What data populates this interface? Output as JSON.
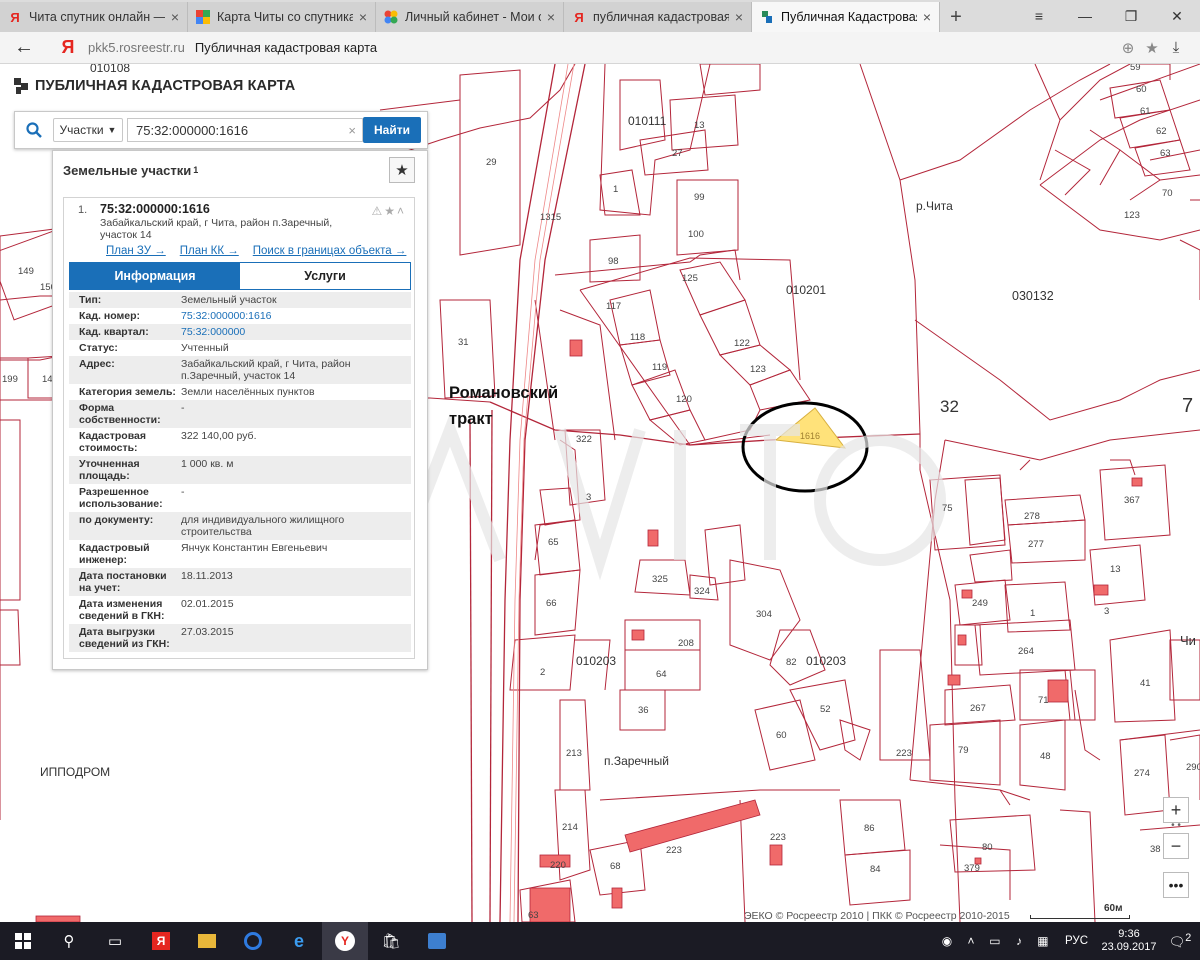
{
  "browser": {
    "tabs": [
      {
        "title": "Чита спутник онлайн — Ян",
        "favicon": "yandex-icon",
        "active": false
      },
      {
        "title": "Карта Читы со спутника - у",
        "favicon": "map-icon",
        "active": false
      },
      {
        "title": "Личный кабинет - Мои объ",
        "favicon": "colorful-icon",
        "active": false
      },
      {
        "title": "публичная кадастровая кар",
        "favicon": "yandex-icon",
        "active": false
      },
      {
        "title": "Публичная Кадастровая",
        "favicon": "pkk-icon",
        "active": true
      }
    ],
    "new_tab": "+",
    "address_host": "pkk5.rosreestr.ru",
    "address_title": "Публичная кадастровая карта",
    "yandex_letter": "Я"
  },
  "app": {
    "title": "ПУБЛИЧНАЯ КАДАСТРОВАЯ КАРТА",
    "search": {
      "select": "Участки",
      "query": "75:32:000000:1616",
      "button": "Найти"
    },
    "panel": {
      "heading": "Земельные участки",
      "heading_sup": "1",
      "item_num": "1.",
      "cad_number": "75:32:000000:1616",
      "address": "Забайкальский край, г Чита, район п.Заречный, участок 14",
      "links": [
        "План ЗУ →",
        "План КК →",
        "Поиск в границах объекта →"
      ],
      "tabs": [
        "Информация",
        "Услуги"
      ],
      "rows": [
        {
          "k": "Тип:",
          "v": "Земельный участок",
          "link": false
        },
        {
          "k": "Кад. номер:",
          "v": "75:32:000000:1616",
          "link": true
        },
        {
          "k": "Кад. квартал:",
          "v": "75:32:000000",
          "link": true
        },
        {
          "k": "Статус:",
          "v": "Учтенный",
          "link": false
        },
        {
          "k": "Адрес:",
          "v": "Забайкальский край, г Чита, район п.Заречный, участок 14",
          "link": false
        },
        {
          "k": "Категория земель:",
          "v": "Земли населённых пунктов",
          "link": false
        },
        {
          "k": "Форма собственности:",
          "v": "-",
          "link": false
        },
        {
          "k": "Кадастровая стоимость:",
          "v": "322 140,00 руб.",
          "link": false
        },
        {
          "k": "Уточненная площадь:",
          "v": "1 000 кв. м",
          "link": false
        },
        {
          "k": "Разрешенное использование:",
          "v": "-",
          "link": false
        },
        {
          "k": "по документу:",
          "v": "для индивидуального жилищного строительства",
          "link": false
        },
        {
          "k": "Кадастровый инженер:",
          "v": "Янчук Константин Евгеньевич",
          "link": false
        },
        {
          "k": "Дата постановки на учет:",
          "v": "18.11.2013",
          "link": false
        },
        {
          "k": "Дата изменения сведений в ГКН:",
          "v": "02.01.2015",
          "link": false
        },
        {
          "k": "Дата выгрузки сведений из ГКН:",
          "v": "27.03.2015",
          "link": false
        }
      ]
    }
  },
  "map": {
    "labels": {
      "road": "Романовский",
      "road2": "тракт",
      "river": "р.Чита",
      "hippodrome": "ИППОДРОМ",
      "village": "п.Заречный",
      "city": "Чи",
      "q010201": "010201",
      "q030132": "030132",
      "q010203a": "010203",
      "q010203b": "010203",
      "q010111": "010111",
      "q010108": "010108",
      "n32": "32",
      "n7": "7",
      "plot": "1616"
    },
    "copyright": "ЭЕКО © Росреестр 2010 | ПКК © Росреестр 2010-2015",
    "scale": "60м",
    "highlight_color": "#ffe27a",
    "boundary_color": "#b3263a",
    "building_color": "#f06a6a"
  },
  "taskbar": {
    "lang": "РУС",
    "time": "9:36",
    "date": "23.09.2017",
    "notif_count": "2"
  }
}
